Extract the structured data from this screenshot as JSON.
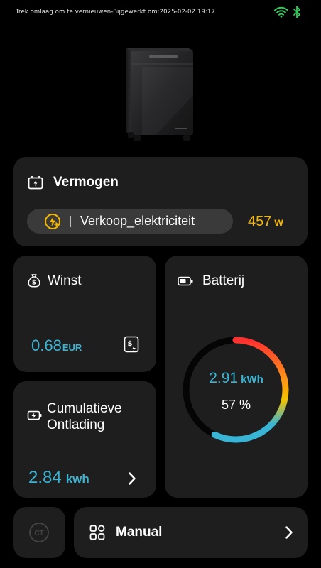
{
  "status_bar": {
    "text": "Trek omlaag om te vernieuwen-Bijgewerkt om:2025-02-02 19:17",
    "icons": [
      "wifi-icon",
      "bluetooth-icon"
    ],
    "icon_color": "#34c759"
  },
  "device": {
    "image": "battery-storage-unit"
  },
  "power_card": {
    "title": "Vermogen",
    "mode_label": "Verkoop_elektriciteit",
    "value": "457",
    "unit": "w",
    "accent_color": "#f5b700"
  },
  "profit_card": {
    "title": "Winst",
    "value": "0.68",
    "unit": "EUR"
  },
  "discharge_card": {
    "title": "Cumulatieve Ontlading",
    "value": "2.84",
    "unit": "kwh"
  },
  "battery_card": {
    "title": "Batterij",
    "energy_value": "2.91",
    "energy_unit": "kWh",
    "percent_text": "57 %",
    "level": 0.57,
    "accent_color": "#3ab4d4"
  },
  "ct_button": {
    "label": "CT"
  },
  "manual_card": {
    "label": "Manual"
  }
}
